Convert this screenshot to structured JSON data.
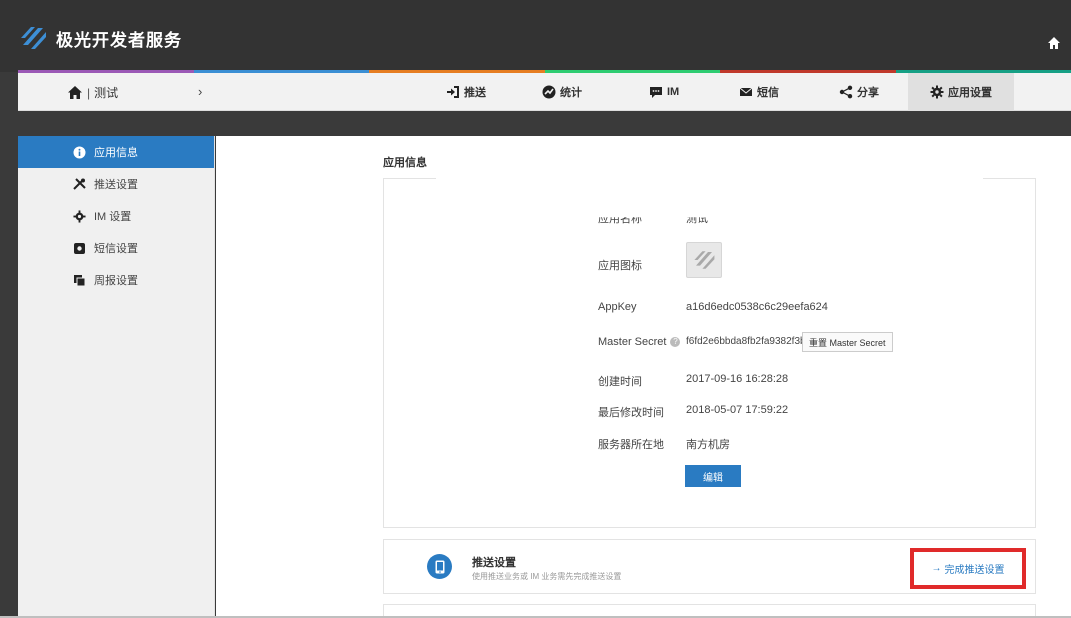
{
  "header": {
    "brand": "极光开发者服务"
  },
  "navbar": {
    "app_name": "测试",
    "separator": "|",
    "chevron": "›",
    "items": [
      {
        "label": "推送",
        "icon": "sign-in-icon"
      },
      {
        "label": "统计",
        "icon": "chart-icon"
      },
      {
        "label": "IM",
        "icon": "chat-icon"
      },
      {
        "label": "短信",
        "icon": "envelope-icon"
      },
      {
        "label": "分享",
        "icon": "share-icon"
      },
      {
        "label": "应用设置",
        "icon": "gear-icon",
        "active": true
      }
    ]
  },
  "sidebar": {
    "items": [
      {
        "label": "应用信息",
        "icon": "info-icon",
        "active": true
      },
      {
        "label": "推送设置",
        "icon": "tools-icon"
      },
      {
        "label": "IM 设置",
        "icon": "gear-icon"
      },
      {
        "label": "短信设置",
        "icon": "sms-icon"
      },
      {
        "label": "周报设置",
        "icon": "report-icon"
      }
    ]
  },
  "main": {
    "title": "应用信息",
    "rows": {
      "app_name_label": "应用名称",
      "app_name_value": "测试",
      "app_icon_label": "应用图标",
      "appkey_label": "AppKey",
      "appkey_value": "a16d6edc0538c6c29eefa624",
      "master_secret_label": "Master Secret",
      "master_secret_help": "?",
      "master_secret_value": "f6fd2e6bbda8fb2fa9382f3b",
      "reset_button": "重置 Master Secret",
      "created_label": "创建时间",
      "created_value": "2017-09-16 16:28:28",
      "modified_label": "最后修改时间",
      "modified_value": "2018-05-07 17:59:22",
      "server_label": "服务器所在地",
      "server_value": "南方机房"
    },
    "edit_button": "编辑"
  },
  "push_card": {
    "title": "推送设置",
    "description": "使用推送业务或 IM 业务需先完成推送设置",
    "link_arrow": "→",
    "link_label": "完成推送设置"
  },
  "colors": {
    "header_bg": "#333333",
    "accent_blue": "#2a7bc2",
    "highlight_red": "#e02a2a"
  }
}
